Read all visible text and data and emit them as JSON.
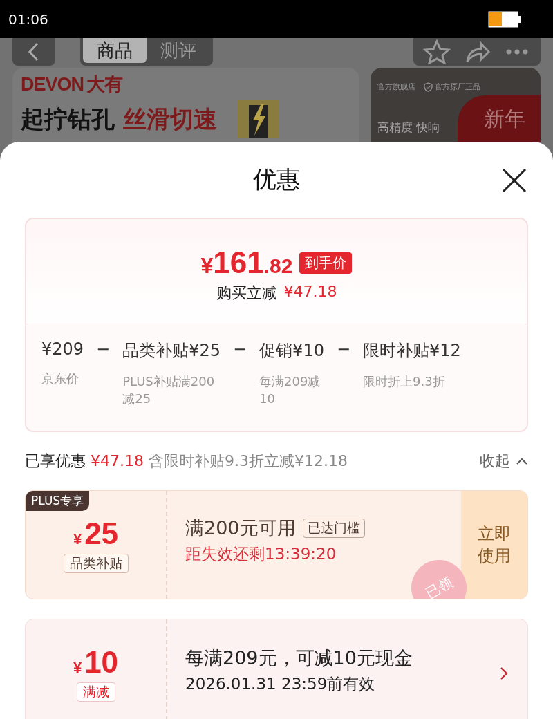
{
  "status_bar": {
    "time": "01:06"
  },
  "background": {
    "tabs": [
      {
        "label": "商品",
        "selected": true
      },
      {
        "label": "测评",
        "selected": false
      }
    ],
    "brand": "DEVON",
    "brand_cn": "大有",
    "headline": "起拧钻孔",
    "headline_accent": "丝滑切速",
    "store_label": "官方旗舰店",
    "store_badge": "官方原厂正品",
    "store_slogan": "高精度 快响",
    "promo": "新年"
  },
  "sheet": {
    "title": "优惠",
    "price": {
      "currency": "¥",
      "integer": "161",
      "decimal": ".82",
      "tag": "到手价",
      "saving_label": "购买立减",
      "saving": "¥47.18"
    },
    "breakdown": [
      {
        "amount": "¥209",
        "note": "京东价"
      },
      {
        "name": "品类补贴",
        "amount": "¥25",
        "note": "PLUS补贴满200减25"
      },
      {
        "name": "促销",
        "amount": "¥10",
        "note": "每满209减10"
      },
      {
        "name": "限时补贴",
        "amount": "¥12",
        "note": "限时折上9.3折"
      }
    ],
    "operator": "−",
    "summary": {
      "label": "已享优惠",
      "amount": "¥47.18",
      "detail": "含限时补贴9.3折立减¥12.18",
      "toggle": "收起"
    },
    "coupons": [
      {
        "kind": "plus",
        "badge": "PLUS专享",
        "currency": "¥",
        "amount": "25",
        "tag": "品类补贴",
        "title": "满200元可用",
        "status": "已达门槛",
        "subtitle": "距失效还剩13:39:20",
        "action": "立即使用",
        "stamp": "已领"
      },
      {
        "kind": "discount",
        "currency": "¥",
        "amount": "10",
        "tag": "满减",
        "title": "每满209元，可减10元现金",
        "subtitle": "2026.01.31 23:59前有效"
      }
    ]
  }
}
